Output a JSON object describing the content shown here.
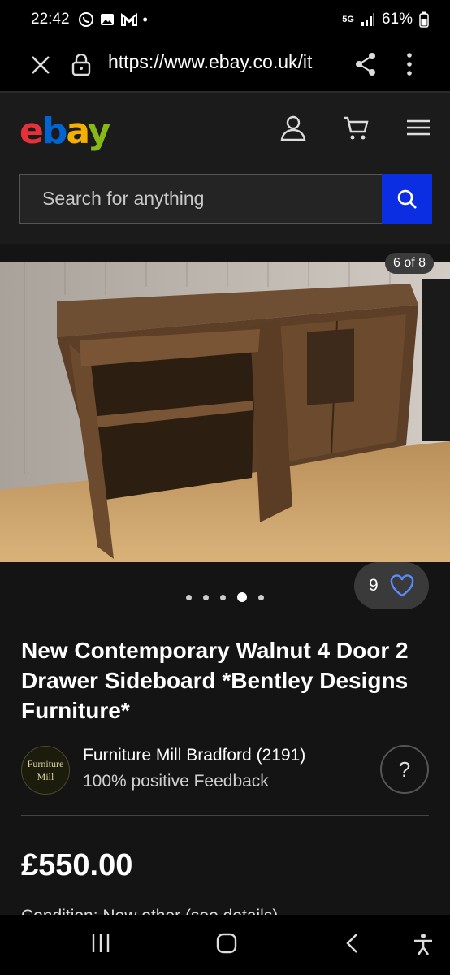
{
  "status": {
    "time": "22:42",
    "notif_icons": [
      "whatsapp-icon",
      "gallery-icon",
      "gmail-icon"
    ],
    "dot": "•",
    "network": "5G",
    "battery": "61%"
  },
  "browser": {
    "url": "https://www.ebay.co.uk/it"
  },
  "header": {
    "logo": {
      "e": "e",
      "b": "b",
      "a": "a",
      "y": "y"
    },
    "search_placeholder": "Search for anything"
  },
  "gallery": {
    "counter": "6 of 8",
    "dots_total": 5,
    "active_dot": 3,
    "watch_count": "9"
  },
  "listing": {
    "title": "New Contemporary Walnut 4 Door 2 Drawer Sideboard *Bentley Designs Furniture*",
    "seller": {
      "avatar_line1": "Furniture",
      "avatar_line2": "Mill",
      "name": "Furniture Mill Bradford (2191)",
      "feedback": "100% positive Feedback",
      "help": "?"
    },
    "price": "£550.00",
    "peek_line": "Condition:    New other (see details)"
  },
  "colors": {
    "ebay_red": "#e53238",
    "ebay_blue": "#0064d2",
    "ebay_yellow": "#f5af02",
    "ebay_green": "#86b817",
    "search_button": "#0c2ee2"
  }
}
